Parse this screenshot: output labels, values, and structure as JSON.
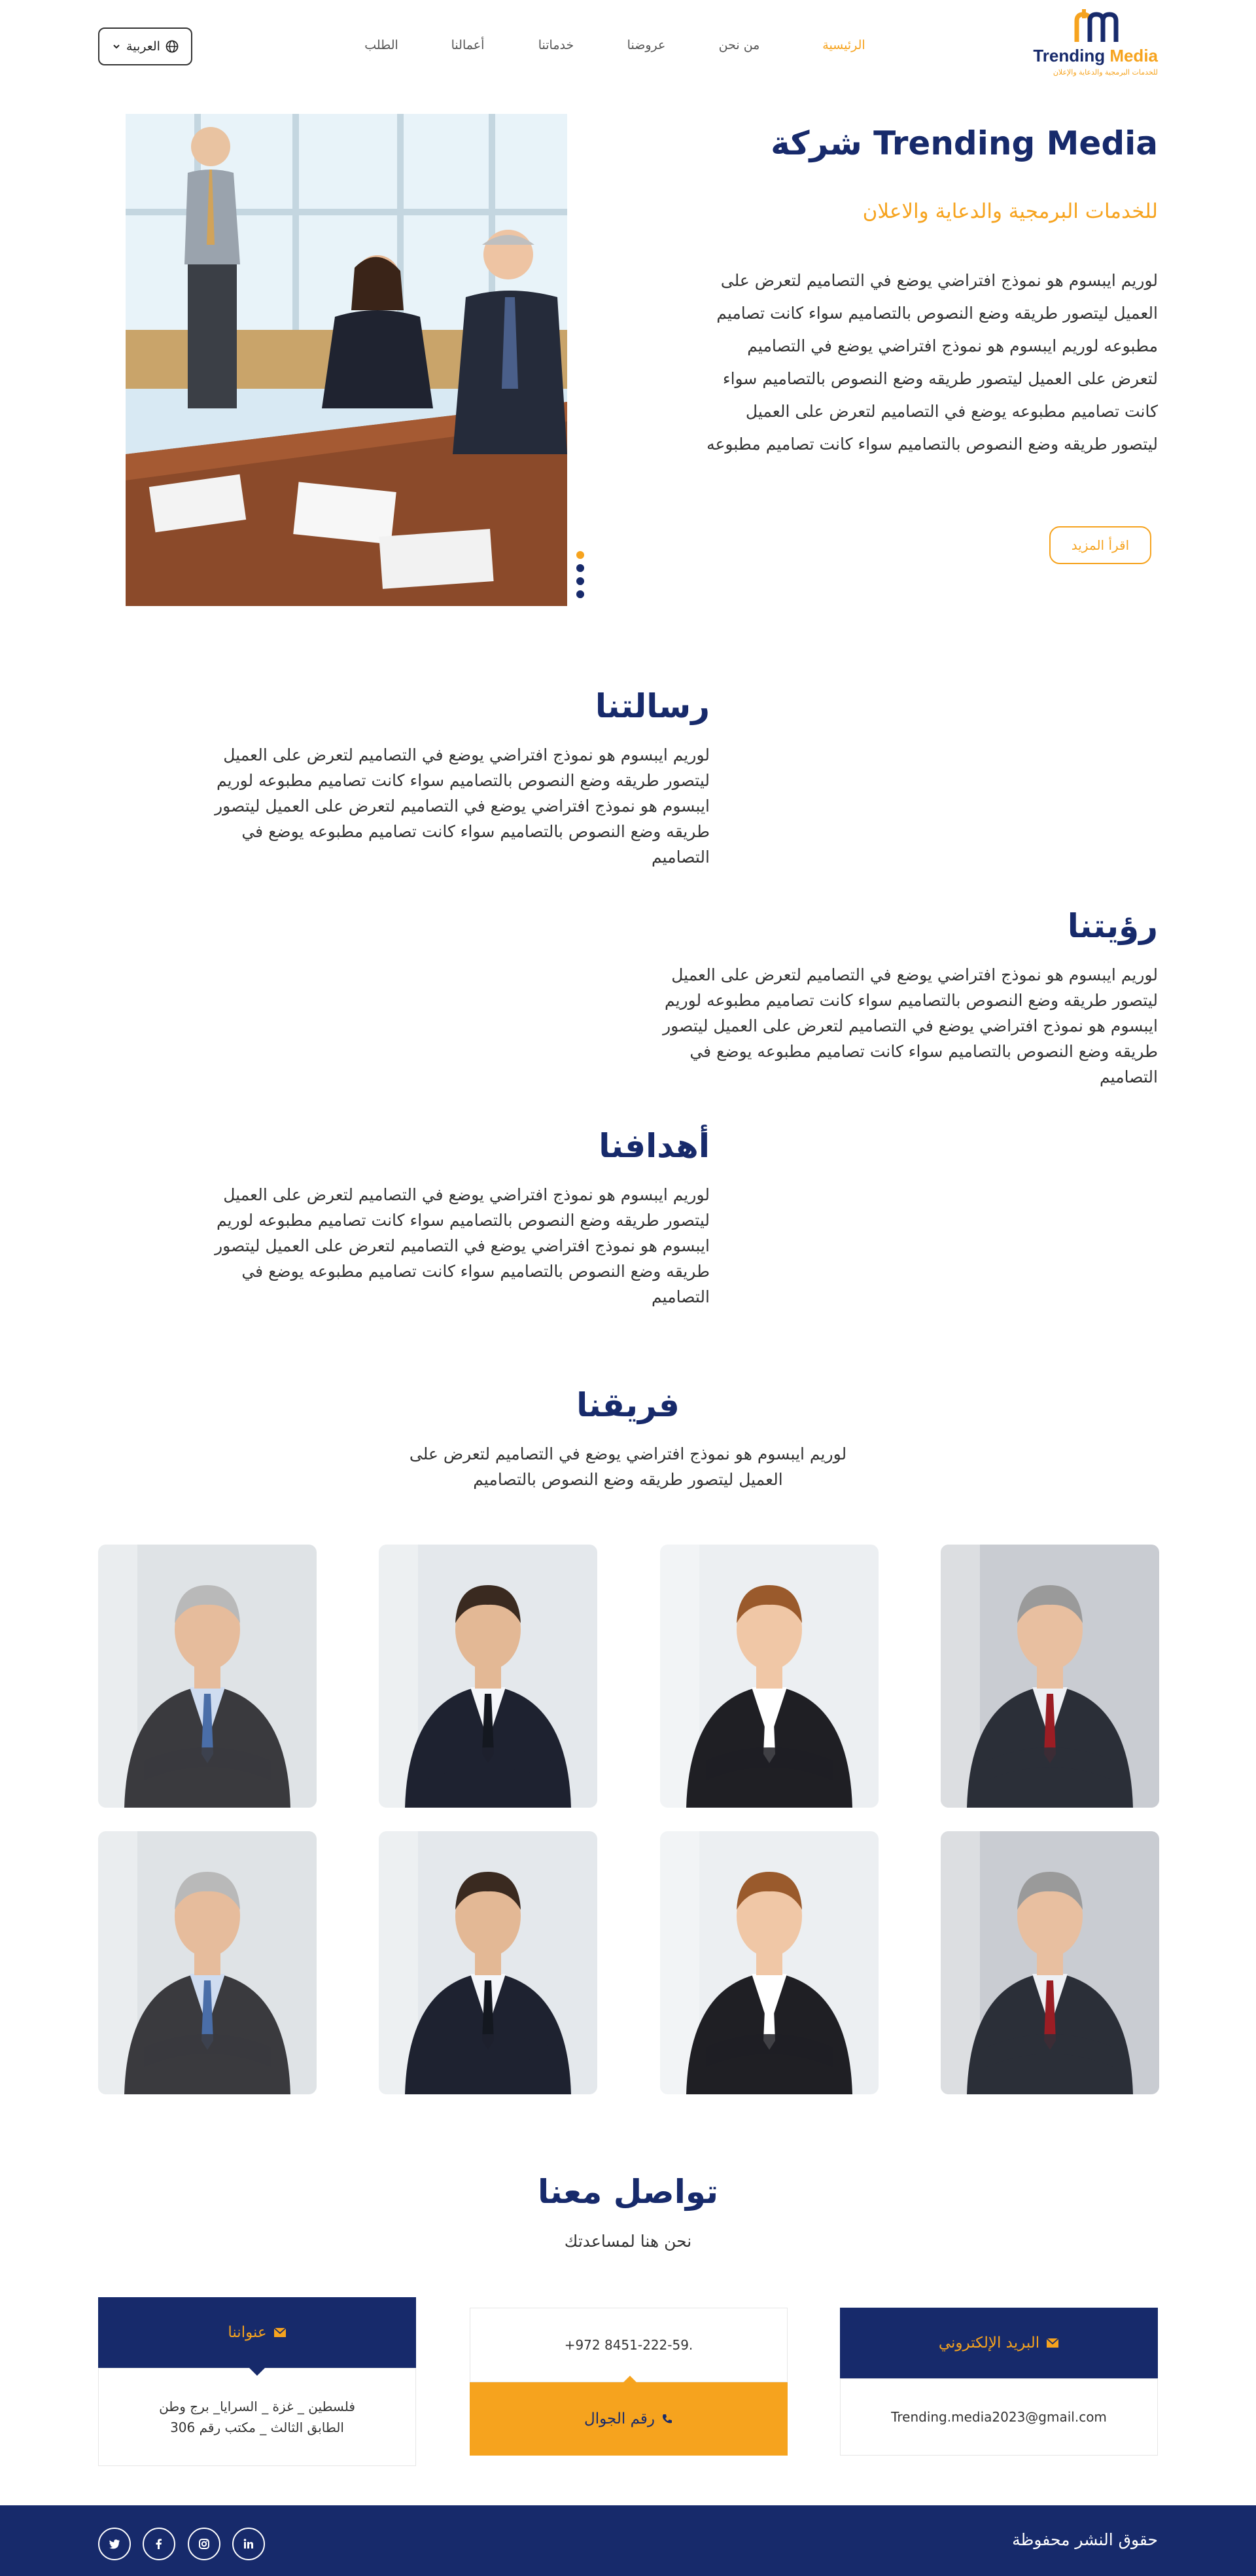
{
  "brand": {
    "name": "Trending Media",
    "tagline": "للخدمات البرمجية والدعاية والإعلان",
    "colors": {
      "navy": "#172a6b",
      "orange": "#f6a31e"
    }
  },
  "nav": {
    "items": [
      {
        "label": "الرئيسية",
        "active": true
      },
      {
        "label": "من نحن",
        "active": false
      },
      {
        "label": "عروضنا",
        "active": false
      },
      {
        "label": "خدماتنا",
        "active": false
      },
      {
        "label": "أعمالنا",
        "active": false
      },
      {
        "label": "الطلب",
        "active": false
      }
    ],
    "language_label": "العربية",
    "language_icon": "globe-icon"
  },
  "hero": {
    "title": "شركة Trending Media",
    "subtitle": "للخدمات البرمجية والدعاية والاعلان",
    "text": "لوريم ايبسوم هو نموذج افتراضي يوضع في التصاميم لتعرض على العميل ليتصور طريقه وضع النصوص بالتصاميم سواء كانت تصاميم مطبوعه لوريم ايبسوم هو نموذج افتراضي يوضع في التصاميم لتعرض على العميل ليتصور طريقه وضع النصوص بالتصاميم سواء كانت تصاميم مطبوعه يوضع في التصاميم لتعرض على العميل ليتصور طريقه وضع النصوص بالتصاميم سواء كانت تصاميم مطبوعه",
    "read_more_label": "اقرأ المزيد",
    "slider_dots": 4,
    "active_dot": 0
  },
  "mission": {
    "title": "رسالتنا",
    "text": "لوريم ايبسوم هو نموذج افتراضي يوضع في التصاميم لتعرض على العميل ليتصور طريقه وضع النصوص بالتصاميم سواء كانت تصاميم مطبوعه لوريم ايبسوم هو نموذج افتراضي يوضع في التصاميم لتعرض على العميل ليتصور طريقه وضع النصوص بالتصاميم سواء كانت تصاميم مطبوعه يوضع في التصاميم"
  },
  "vision": {
    "title": "رؤيتنا",
    "text": "لوريم ايبسوم هو نموذج افتراضي يوضع في التصاميم لتعرض على العميل ليتصور طريقه وضع النصوص بالتصاميم سواء كانت تصاميم مطبوعه لوريم ايبسوم هو نموذج افتراضي يوضع في التصاميم لتعرض على العميل ليتصور طريقه وضع النصوص بالتصاميم سواء كانت تصاميم مطبوعه يوضع في التصاميم"
  },
  "goals": {
    "title": "أهدافنا",
    "text": "لوريم ايبسوم هو نموذج افتراضي يوضع في التصاميم لتعرض على العميل ليتصور طريقه وضع النصوص بالتصاميم سواء كانت تصاميم مطبوعه لوريم ايبسوم هو نموذج افتراضي يوضع في التصاميم لتعرض على العميل ليتصور طريقه وضع النصوص بالتصاميم سواء كانت تصاميم مطبوعه يوضع في التصاميم"
  },
  "team": {
    "title": "فريقنا",
    "text": "لوريم ايبسوم هو نموذج افتراضي يوضع في التصاميم لتعرض على العميل ليتصور طريقه وضع النصوص بالتصاميم"
  },
  "contact": {
    "title": "تواصل معنا",
    "subtitle": "نحن هنا لمساعدتك",
    "email_label": "البريد الإلكتروني",
    "email_value": "Trending.media2023@gmail.com",
    "phone_label": "رقم الجوال",
    "phone_value": "+972 8451-222-59.",
    "address_label": "عنواننا",
    "address_line1": "فلسطين _ غزة _ السرايا_ برج وطن",
    "address_line2": "الطابق الثالث _ مكتب رقم 306"
  },
  "footer": {
    "copyright": "حقوق النشر محفوظة",
    "social": [
      "linkedin-icon",
      "instagram-icon",
      "facebook-icon",
      "twitter-icon"
    ]
  }
}
